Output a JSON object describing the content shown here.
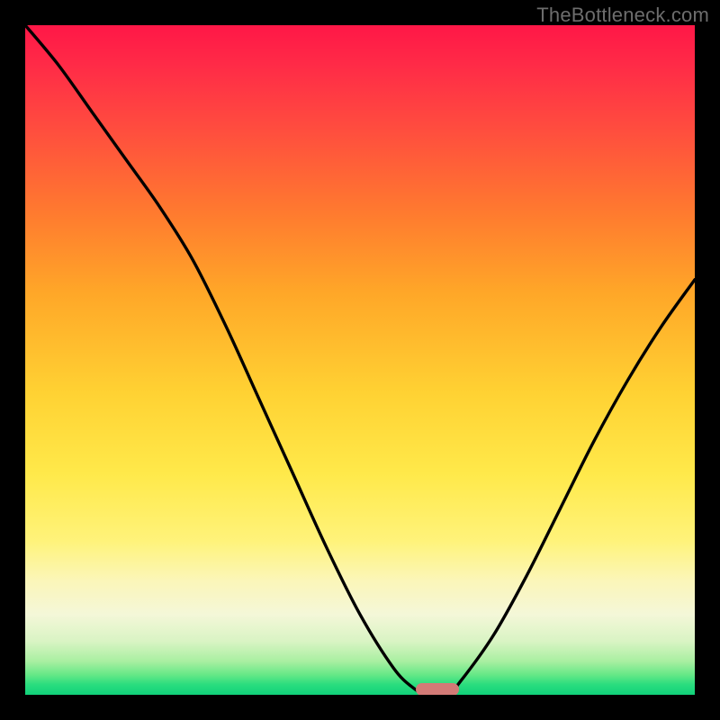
{
  "watermark": "TheBottleneck.com",
  "chart_data": {
    "type": "line",
    "title": "",
    "xlabel": "",
    "ylabel": "",
    "xlim": [
      0,
      1
    ],
    "ylim": [
      0,
      1
    ],
    "series": [
      {
        "name": "bottleneck-curve",
        "x": [
          0.0,
          0.05,
          0.1,
          0.15,
          0.2,
          0.25,
          0.3,
          0.35,
          0.4,
          0.45,
          0.5,
          0.55,
          0.58,
          0.6,
          0.63,
          0.65,
          0.7,
          0.75,
          0.8,
          0.85,
          0.9,
          0.95,
          1.0
        ],
        "values": [
          1.0,
          0.94,
          0.87,
          0.8,
          0.73,
          0.65,
          0.55,
          0.44,
          0.33,
          0.22,
          0.12,
          0.04,
          0.01,
          0.0,
          0.0,
          0.02,
          0.09,
          0.18,
          0.28,
          0.38,
          0.47,
          0.55,
          0.62
        ]
      }
    ],
    "optimal_point": {
      "x": 0.615,
      "y": 0.0
    },
    "gradient_colors": {
      "top": "#ff1747",
      "mid": "#ffe94a",
      "bottom": "#11d27a"
    },
    "marker_color": "#d37a76"
  }
}
